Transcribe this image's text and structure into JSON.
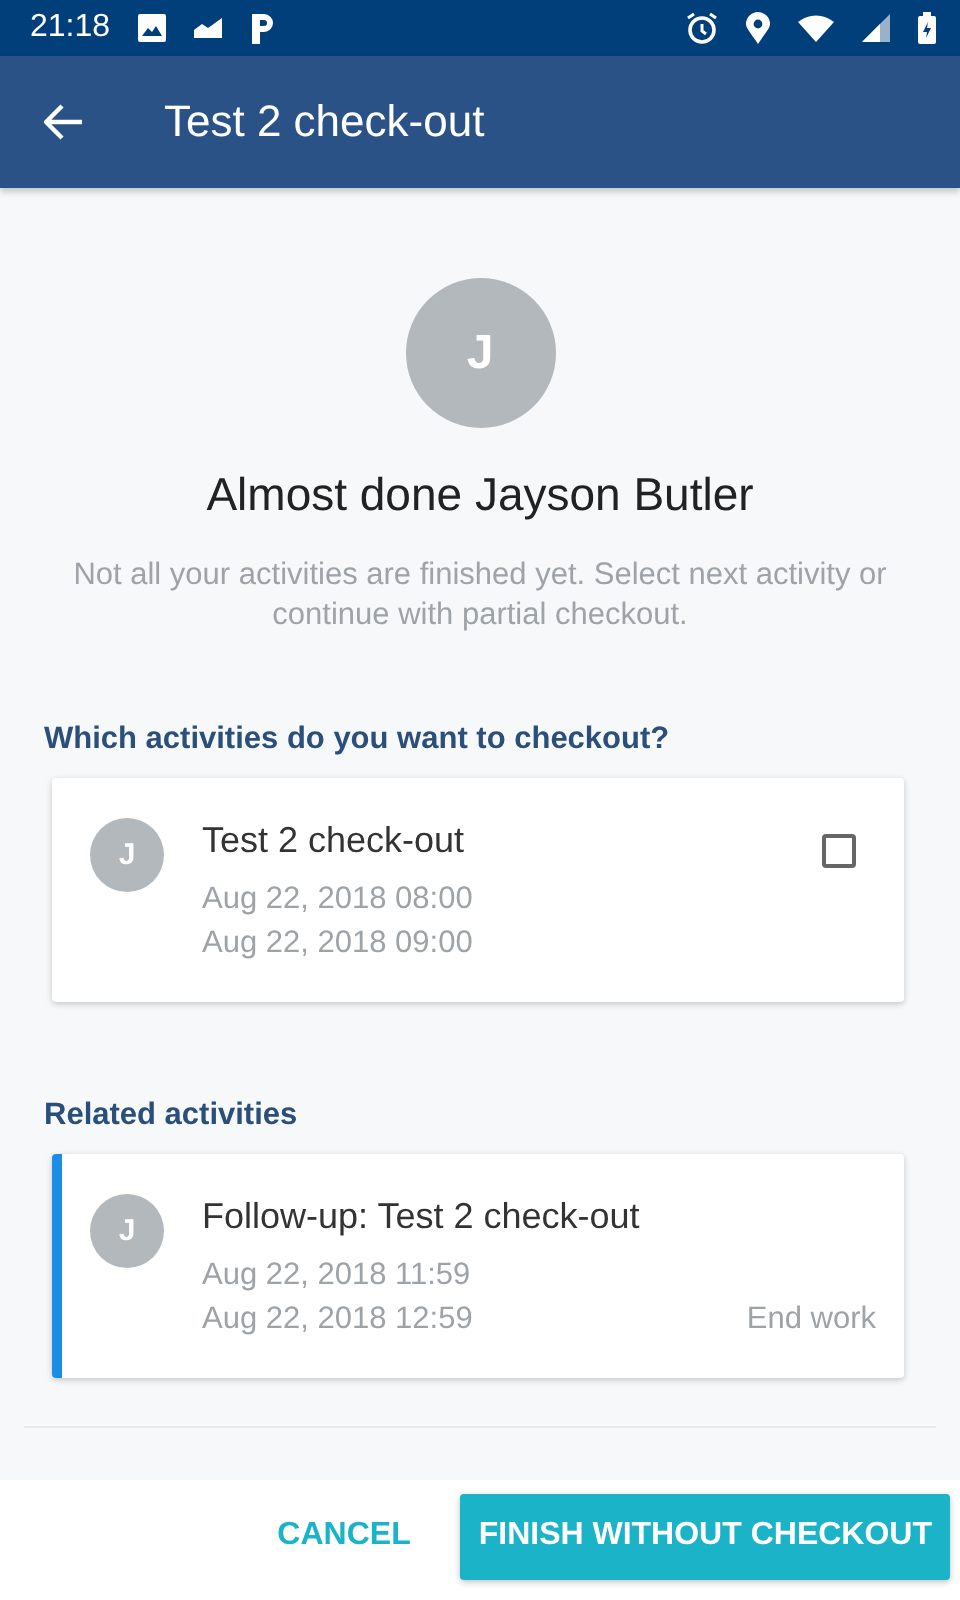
{
  "status_bar": {
    "time": "21:18"
  },
  "app_bar": {
    "title": "Test 2 check-out"
  },
  "avatar": {
    "initial": "J"
  },
  "heading": "Almost done Jayson Butler",
  "message": "Not all your activities are finished yet. Select next activity or continue with partial checkout.",
  "sections": [
    {
      "title": "Which activities do you want to checkout?",
      "cards": [
        {
          "kind": "checkable",
          "initial": "J",
          "title": "Test 2 check-out",
          "start": "Aug 22, 2018 08:00",
          "end": "Aug 22, 2018 09:00",
          "checked": false
        }
      ]
    },
    {
      "title": "Related activities",
      "cards": [
        {
          "kind": "related",
          "initial": "J",
          "title": "Follow-up: Test 2 check-out",
          "start": "Aug 22, 2018 11:59",
          "end": "Aug 22, 2018 12:59",
          "status": "End work"
        }
      ]
    }
  ],
  "actions": {
    "cancel": "CANCEL",
    "finish": "FINISH WITHOUT CHECKOUT"
  }
}
